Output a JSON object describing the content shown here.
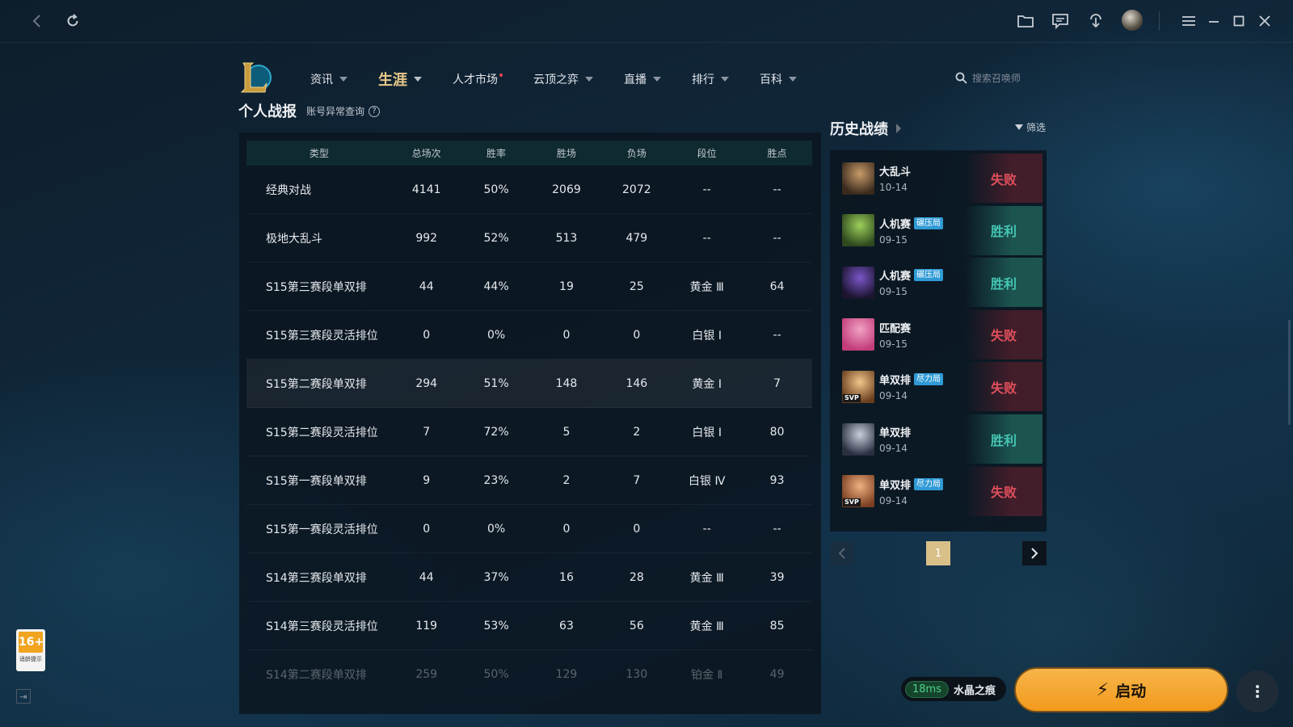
{
  "nav": {
    "items": [
      {
        "label": "资讯",
        "caret": true
      },
      {
        "label": "生涯",
        "caret": true,
        "active": true
      },
      {
        "label": "人才市场",
        "dot": true
      },
      {
        "label": "云顶之弈",
        "caret": true
      },
      {
        "label": "直播",
        "caret": true
      },
      {
        "label": "排行",
        "caret": true
      },
      {
        "label": "百科",
        "caret": true
      }
    ],
    "search_placeholder": "搜索召唤师"
  },
  "stats": {
    "title": "个人战报",
    "abnormal_link": "账号异常查询",
    "help": "?",
    "columns": [
      "类型",
      "总场次",
      "胜率",
      "胜场",
      "负场",
      "段位",
      "胜点"
    ],
    "rows": [
      [
        "经典对战",
        "4141",
        "50%",
        "2069",
        "2072",
        "--",
        "--"
      ],
      [
        "极地大乱斗",
        "992",
        "52%",
        "513",
        "479",
        "--",
        "--"
      ],
      [
        "S15第三赛段单双排",
        "44",
        "44%",
        "19",
        "25",
        "黄金 Ⅲ",
        "64"
      ],
      [
        "S15第三赛段灵活排位",
        "0",
        "0%",
        "0",
        "0",
        "白银 Ⅰ",
        "--"
      ],
      [
        "S15第二赛段单双排",
        "294",
        "51%",
        "148",
        "146",
        "黄金 Ⅰ",
        "7"
      ],
      [
        "S15第二赛段灵活排位",
        "7",
        "72%",
        "5",
        "2",
        "白银 Ⅰ",
        "80"
      ],
      [
        "S15第一赛段单双排",
        "9",
        "23%",
        "2",
        "7",
        "白银 Ⅳ",
        "93"
      ],
      [
        "S15第一赛段灵活排位",
        "0",
        "0%",
        "0",
        "0",
        "--",
        "--"
      ],
      [
        "S14第三赛段单双排",
        "44",
        "37%",
        "16",
        "28",
        "黄金 Ⅲ",
        "39"
      ],
      [
        "S14第三赛段灵活排位",
        "119",
        "53%",
        "63",
        "56",
        "黄金 Ⅲ",
        "85"
      ],
      [
        "S14第二赛段单双排",
        "259",
        "50%",
        "129",
        "130",
        "铂金 Ⅱ",
        "49"
      ]
    ]
  },
  "history": {
    "title": "历史战绩",
    "filter_label": "筛选",
    "matches": [
      {
        "mode": "大乱斗",
        "tag": "",
        "date": "10-14",
        "result": "失败",
        "win": false,
        "svp": false,
        "colors": [
          "#3a2a1c",
          "#c89b6a"
        ]
      },
      {
        "mode": "人机赛",
        "tag": "碾压局",
        "date": "09-15",
        "result": "胜利",
        "win": true,
        "svp": false,
        "colors": [
          "#2f4a1f",
          "#9ccf5a"
        ]
      },
      {
        "mode": "人机赛",
        "tag": "碾压局",
        "date": "09-15",
        "result": "胜利",
        "win": true,
        "svp": false,
        "colors": [
          "#1c1530",
          "#7a56c8"
        ]
      },
      {
        "mode": "匹配赛",
        "tag": "",
        "date": "09-15",
        "result": "失败",
        "win": false,
        "svp": false,
        "colors": [
          "#c23d7a",
          "#f1a2c3"
        ]
      },
      {
        "mode": "单双排",
        "tag": "尽力局",
        "date": "09-14",
        "result": "失败",
        "win": false,
        "svp": true,
        "svp_label": "SVP",
        "colors": [
          "#6a3f1e",
          "#f2c68a"
        ]
      },
      {
        "mode": "单双排",
        "tag": "",
        "date": "09-14",
        "result": "胜利",
        "win": true,
        "svp": false,
        "colors": [
          "#2a3040",
          "#c8cedc"
        ]
      },
      {
        "mode": "单双排",
        "tag": "尽力局",
        "date": "09-14",
        "result": "失败",
        "win": false,
        "svp": true,
        "svp_label": "SVP",
        "colors": [
          "#7a3f22",
          "#f0b080"
        ]
      }
    ],
    "page": "1"
  },
  "bottom": {
    "age_rating": "16+",
    "age_note": "适龄提示",
    "collapse_icon": "⇥",
    "ping": "18ms",
    "server": "水晶之痕",
    "launch_label": "启动",
    "bolt": "⚡"
  }
}
